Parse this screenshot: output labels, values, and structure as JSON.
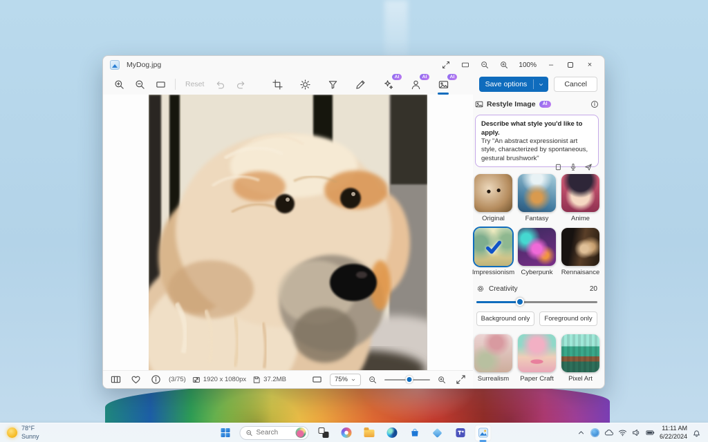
{
  "desktop": {
    "weather": {
      "temp": "78°F",
      "condition": "Sunny"
    },
    "taskbar": {
      "search_placeholder": "Search",
      "time": "11:11 AM",
      "date": "6/22/2024"
    }
  },
  "window": {
    "title": "MyDog.jpg",
    "titlebar_zoom": "100%",
    "toolbar": {
      "reset": "Reset"
    },
    "actions": {
      "save": "Save options",
      "cancel": "Cancel"
    },
    "panel": {
      "title": "Restyle Image",
      "ai_badge": "AI",
      "prompt_heading": "Describe what style you'd like to apply.",
      "prompt_body": "Try \"An abstract expressionist art style, characterized by spontaneous, gestural brushwork\"",
      "styles": [
        {
          "label": "Original",
          "selected": false
        },
        {
          "label": "Fantasy",
          "selected": false
        },
        {
          "label": "Anime",
          "selected": false
        },
        {
          "label": "Impressionism",
          "selected": true
        },
        {
          "label": "Cyberpunk",
          "selected": false
        },
        {
          "label": "Rennaisance",
          "selected": false
        },
        {
          "label": "Surrealism",
          "selected": false
        },
        {
          "label": "Paper Craft",
          "selected": false
        },
        {
          "label": "Pixel Art",
          "selected": false
        }
      ],
      "creativity": {
        "label": "Creativity",
        "value": "20",
        "percent": "36%"
      },
      "background_only": "Background only",
      "foreground_only": "Foreground only"
    },
    "statusbar": {
      "counter": "(3/75)",
      "dimensions": "1920 x 1080px",
      "filesize": "37.2MB",
      "zoom": "75%",
      "zoom_percent": "55%"
    }
  },
  "ui_glyphs": {
    "minimize": "–",
    "close": "×"
  },
  "colors": {
    "accent": "#0f6cbd",
    "ai_badge_gradient": "#8a6cf0",
    "prompt_border": "#c5a8e8"
  }
}
